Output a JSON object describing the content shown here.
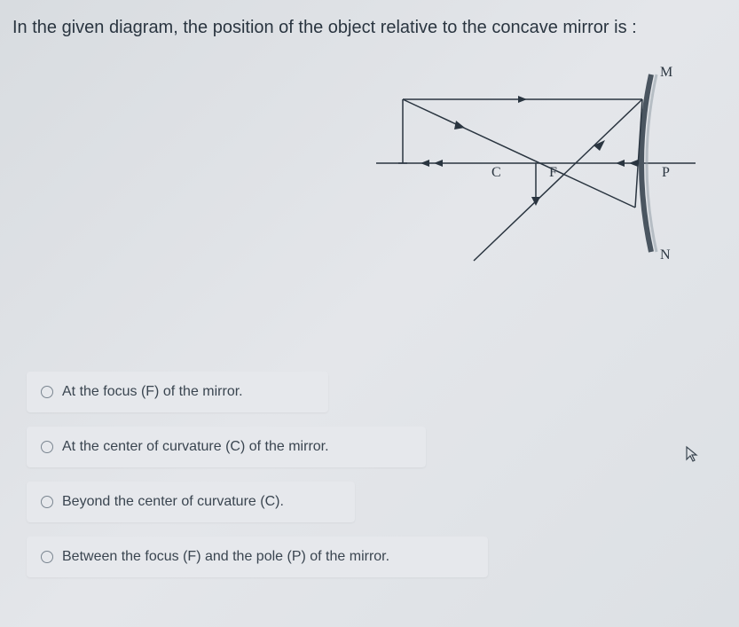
{
  "question": "In the given diagram, the position of the object relative to the concave mirror is :",
  "diagram": {
    "labels": {
      "M": "M",
      "N": "N",
      "C": "C",
      "F": "F",
      "P": "P"
    }
  },
  "options": [
    "At the focus (F) of the mirror.",
    "At the center of curvature (C) of the mirror.",
    "Beyond the center of curvature (C).",
    "Between the focus (F) and the pole (P) of the mirror."
  ]
}
